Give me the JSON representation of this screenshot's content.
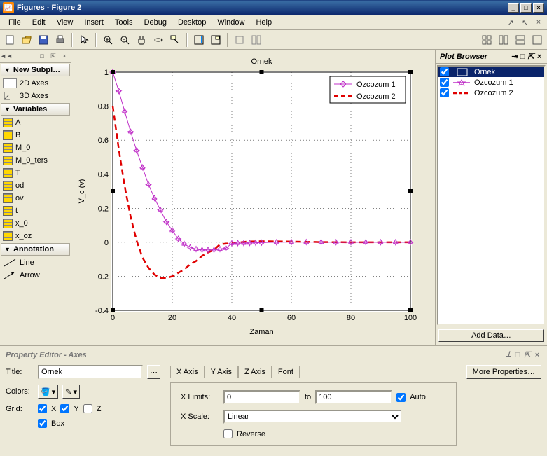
{
  "window": {
    "title": "Figures - Figure 2"
  },
  "menu": {
    "file": "File",
    "edit": "Edit",
    "view": "View",
    "insert": "Insert",
    "tools": "Tools",
    "debug": "Debug",
    "desktop": "Desktop",
    "window": "Window",
    "help": "Help"
  },
  "left": {
    "new_subplots": "New Subpl…",
    "axes2d": "2D Axes",
    "axes3d": "3D Axes",
    "variables": "Variables",
    "vars": [
      "A",
      "B",
      "M_0",
      "M_0_ters",
      "T",
      "od",
      "ov",
      "t",
      "x_0",
      "x_oz"
    ],
    "annotation": "Annotation",
    "line": "Line",
    "arrow": "Arrow"
  },
  "plot_browser": {
    "title": "Plot Browser",
    "items": [
      {
        "label": "Ornek",
        "selected": true
      },
      {
        "label": "Ozcozum 1",
        "selected": false
      },
      {
        "label": "Ozcozum 2",
        "selected": false
      }
    ],
    "add_data": "Add Data…"
  },
  "prop": {
    "header": "Property Editor - Axes",
    "title_label": "Title:",
    "title_value": "Ornek",
    "colors_label": "Colors:",
    "grid_label": "Grid:",
    "gx": "X",
    "gy": "Y",
    "gz": "Z",
    "box_label": "Box",
    "tab_x": "X Axis",
    "tab_y": "Y Axis",
    "tab_z": "Z Axis",
    "tab_font": "Font",
    "xlimits_label": "X Limits:",
    "xmin": "0",
    "to": "to",
    "xmax": "100",
    "auto": "Auto",
    "xscale_label": "X Scale:",
    "xscale_value": "Linear",
    "reverse": "Reverse",
    "more": "More Properties…"
  },
  "chart_data": {
    "type": "line",
    "title": "Ornek",
    "xlabel": "Zaman",
    "ylabel": "V_c (v)",
    "xlim": [
      0,
      100
    ],
    "ylim": [
      -0.4,
      1.0
    ],
    "xticks": [
      0,
      20,
      40,
      60,
      80,
      100
    ],
    "yticks": [
      -0.4,
      -0.2,
      0,
      0.2,
      0.4,
      0.6,
      0.8,
      1.0
    ],
    "legend": {
      "entries": [
        "Ozcozum 1",
        "Ozcozum 2"
      ],
      "position": "top-right"
    },
    "grid": true,
    "series": [
      {
        "name": "Ozcozum 1",
        "style": "line-with-hexagram-markers",
        "color": "#c030c8",
        "x": [
          0,
          2,
          4,
          6,
          8,
          10,
          12,
          14,
          16,
          18,
          20,
          22,
          24,
          26,
          28,
          30,
          32,
          34,
          36,
          38,
          40,
          42,
          44,
          46,
          48,
          50,
          55,
          60,
          65,
          70,
          75,
          80,
          85,
          90,
          95,
          100
        ],
        "y": [
          1.0,
          0.89,
          0.77,
          0.65,
          0.54,
          0.44,
          0.34,
          0.26,
          0.19,
          0.12,
          0.07,
          0.02,
          -0.01,
          -0.03,
          -0.04,
          -0.045,
          -0.045,
          -0.045,
          -0.04,
          -0.035,
          -0.006,
          -0.005,
          -0.005,
          -0.004,
          -0.003,
          -0.002,
          0.0,
          0.001,
          0.001,
          0.001,
          0.0,
          0.0,
          0.0,
          0.0,
          0.0,
          0.0
        ]
      },
      {
        "name": "Ozcozum 2",
        "style": "dashed",
        "color": "#e00000",
        "x": [
          0,
          2,
          4,
          6,
          8,
          10,
          12,
          14,
          16,
          18,
          20,
          22,
          24,
          26,
          28,
          30,
          32,
          34,
          36,
          38,
          40,
          45,
          50,
          55,
          60,
          70,
          80,
          90,
          100
        ],
        "y": [
          0.8,
          0.55,
          0.33,
          0.15,
          0.01,
          -0.09,
          -0.15,
          -0.19,
          -0.21,
          -0.21,
          -0.2,
          -0.18,
          -0.16,
          -0.13,
          -0.11,
          -0.08,
          -0.06,
          -0.045,
          -0.012,
          -0.008,
          -0.006,
          0.004,
          0.006,
          0.005,
          0.004,
          0.001,
          0.0,
          0.0,
          0.0
        ]
      }
    ]
  }
}
